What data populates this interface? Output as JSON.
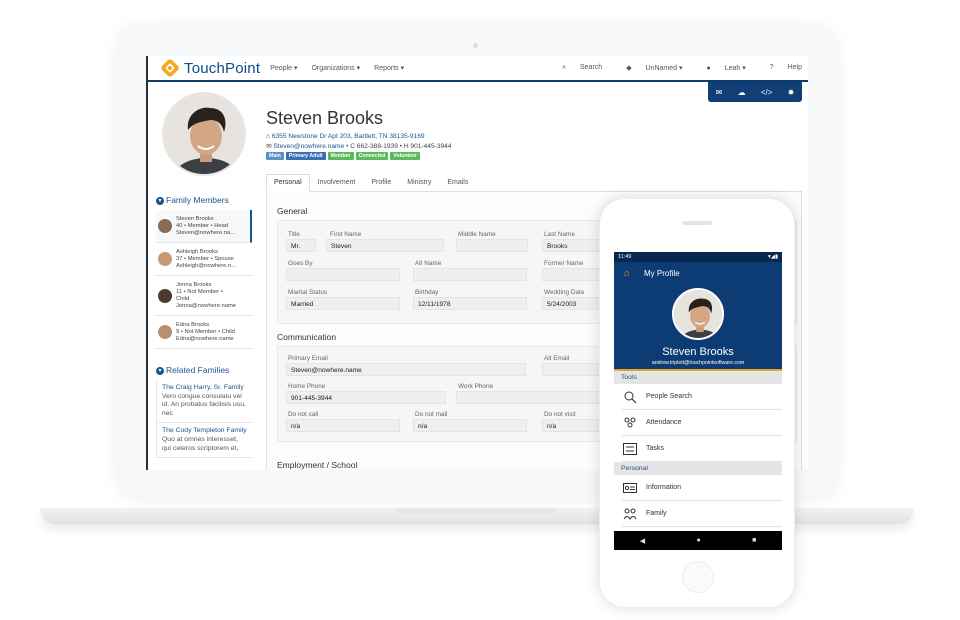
{
  "brand": {
    "name": "TouchPoint",
    "accent": "#f5a623",
    "primary": "#0f3f75"
  },
  "nav": {
    "menus": [
      "People ▾",
      "Organizations ▾",
      "Reports ▾"
    ],
    "search": "Search",
    "tag": "UnNamed ▾",
    "user": "Leah ▾",
    "help": "Help"
  },
  "toolbar_icons": [
    "mail-icon",
    "cloud-download-icon",
    "code-icon",
    "gear-icon"
  ],
  "person": {
    "name": "Steven Brooks",
    "address": "6355 Newstone Dr Apt 203, Bartlett, TN 38135-9169",
    "email": "Steven@nowhere.name",
    "phones": "• C 662-388-1939 • H 901-445-3944",
    "badges": [
      {
        "label": "Main",
        "color": "#5b8fc7"
      },
      {
        "label": "Primary Adult",
        "color": "#3b6fb0"
      },
      {
        "label": "Member",
        "color": "#5cb85c"
      },
      {
        "label": "Connected",
        "color": "#5cb85c"
      },
      {
        "label": "Volunteer",
        "color": "#5cb85c"
      }
    ]
  },
  "family": {
    "heading": "Family Members",
    "members": [
      {
        "name": "Steven Brooks",
        "line2": "40 • Member • Head",
        "line3": "",
        "email": "Steven@nowhere.na...",
        "color": "#8a6a52"
      },
      {
        "name": "Ashleigh Brooks",
        "line2": "37 • Member • Spouse",
        "line3": "",
        "email": "Ashleigh@nowhere.n...",
        "color": "#c49a72"
      },
      {
        "name": "Jenna Brooks",
        "line2": "11 • Not Member •",
        "line3": "Child",
        "email": "Jenna@nowhere.name",
        "color": "#4a3a30"
      },
      {
        "name": "Edna Brooks",
        "line2": "9 • Not Member • Child",
        "line3": "",
        "email": "Edna@nowhere.name",
        "color": "#b89070"
      }
    ]
  },
  "related": {
    "heading": "Related Families",
    "items": [
      {
        "link": "The Craig Harry, Sr. Family",
        "desc": "Vero congue consulatu vel id. An probatus facilisis usu, nec"
      },
      {
        "link": "The Cody Templeton Family",
        "desc": "Quo at omnes interesset, qui ceteros scriptorem et,"
      }
    ]
  },
  "tabs": [
    "Personal",
    "Involvement",
    "Profile",
    "Ministry",
    "Emails"
  ],
  "general": {
    "title": "General",
    "title_label": "Title",
    "title_value": "Mr.",
    "first_label": "First Name",
    "first_value": "Steven",
    "middle_label": "Middle Name",
    "middle_value": "",
    "last_label": "Last Name",
    "last_value": "Brooks",
    "goes_label": "Goes By",
    "goes_value": "",
    "alt_label": "Alt Name",
    "alt_value": "",
    "former_label": "Former Name",
    "former_value": "",
    "marital_label": "Marital Status",
    "marital_value": "Married",
    "birthday_label": "Birthday",
    "birthday_value": "12/11/1978",
    "wedding_label": "Wedding Date",
    "wedding_value": "5/24/2003"
  },
  "communication": {
    "title": "Communication",
    "pemail_label": "Primary Email",
    "pemail_value": "Steven@nowhere.name",
    "altemail_label": "Alt Email",
    "altemail_value": "",
    "home_label": "Home Phone",
    "home_value": "901-445-3944",
    "work_label": "Work Phone",
    "work_value": "",
    "call_label": "Do not call",
    "call_value": "n/a",
    "mail_label": "Do not mail",
    "mail_value": "n/a",
    "visit_label": "Do not visit",
    "visit_value": "n/a"
  },
  "employment": {
    "title": "Employment / School"
  },
  "phone": {
    "time": "11:49",
    "header": "My Profile",
    "name": "Steven Brooks",
    "email": "andrew.triplett@touchpointsoftware.com",
    "tools_label": "Tools",
    "tools": [
      "People Search",
      "Attendance",
      "Tasks"
    ],
    "personal_label": "Personal",
    "personal": [
      "Information",
      "Family"
    ]
  }
}
